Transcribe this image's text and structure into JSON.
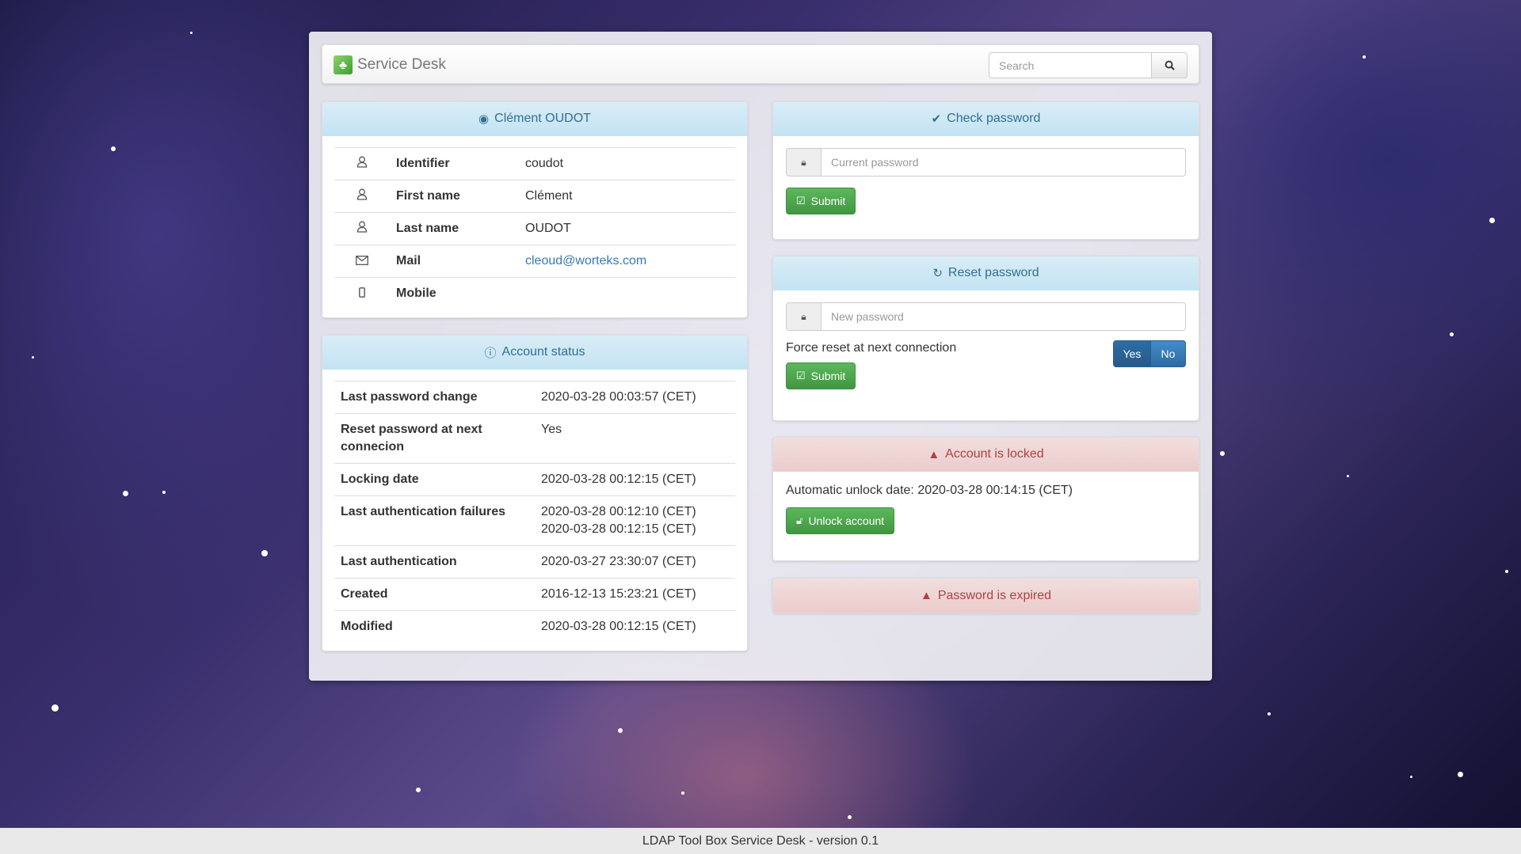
{
  "navbar": {
    "brand": "Service Desk",
    "search_placeholder": "Search"
  },
  "user_panel": {
    "title": "Clément OUDOT",
    "rows": [
      {
        "icon": "user-icon",
        "label": "Identifier",
        "value": "coudot"
      },
      {
        "icon": "user-icon",
        "label": "First name",
        "value": "Clément"
      },
      {
        "icon": "user-icon",
        "label": "Last name",
        "value": "OUDOT"
      },
      {
        "icon": "envelope-icon",
        "label": "Mail",
        "value": "cleoud@worteks.com"
      },
      {
        "icon": "mobile-icon",
        "label": "Mobile",
        "value": ""
      }
    ]
  },
  "account_status": {
    "title": "Account status",
    "rows": [
      {
        "label": "Last password change",
        "value": "2020-03-28 00:03:57 (CET)"
      },
      {
        "label": "Reset password at next connecion",
        "value": "Yes"
      },
      {
        "label": "Locking date",
        "value": "2020-03-28 00:12:15 (CET)"
      },
      {
        "label": "Last authentication failures",
        "value": "2020-03-28 00:12:10 (CET)",
        "value2": "2020-03-28 00:12:15 (CET)"
      },
      {
        "label": "Last authentication",
        "value": "2020-03-27 23:30:07 (CET)"
      },
      {
        "label": "Created",
        "value": "2016-12-13 15:23:21 (CET)"
      },
      {
        "label": "Modified",
        "value": "2020-03-28 00:12:15 (CET)"
      }
    ]
  },
  "check_password": {
    "title": "Check password",
    "placeholder": "Current password",
    "submit": "Submit"
  },
  "reset_password": {
    "title": "Reset password",
    "placeholder": "New password",
    "force_label": "Force reset at next connection",
    "yes": "Yes",
    "no": "No",
    "submit": "Submit"
  },
  "locked": {
    "title": "Account is locked",
    "text": "Automatic unlock date: 2020-03-28 00:14:15 (CET)",
    "button": "Unlock account"
  },
  "expired": {
    "title": "Password is expired"
  },
  "footer": "LDAP Tool Box Service Desk - version 0.1",
  "colors": {
    "info_heading": "#d9edf7",
    "danger_heading": "#f2dede",
    "success_button": "#5cb85c",
    "primary_toggle": "#337ab7"
  }
}
